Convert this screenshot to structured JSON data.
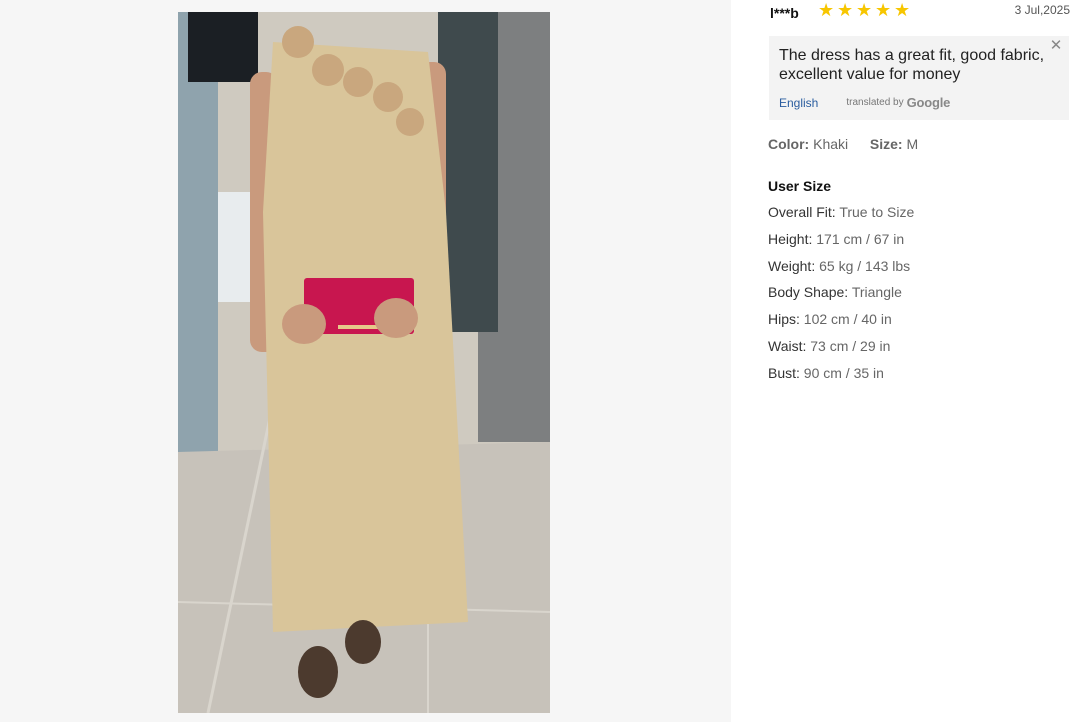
{
  "review": {
    "username": "l***b",
    "rating": 5,
    "date": "3 Jul,2025",
    "translation": {
      "text": "The dress has a great fit, good fabric, excellent value for money",
      "language_link": "English",
      "translated_by": "translated by",
      "provider": "Google",
      "close_icon": "close-icon"
    },
    "attributes": {
      "color_label": "Color:",
      "color_value": "Khaki",
      "size_label": "Size:",
      "size_value": "M"
    },
    "user_size": {
      "title": "User Size",
      "rows": [
        {
          "label": "Overall Fit:",
          "value": "True to Size"
        },
        {
          "label": "Height:",
          "value": "171 cm / 67 in"
        },
        {
          "label": "Weight:",
          "value": "65 kg / 143 lbs"
        },
        {
          "label": "Body Shape:",
          "value": "Triangle"
        },
        {
          "label": "Hips:",
          "value": "102 cm / 40 in"
        },
        {
          "label": "Waist:",
          "value": "73 cm / 29 in"
        },
        {
          "label": "Bust:",
          "value": "90 cm / 35 in"
        }
      ]
    }
  },
  "colors": {
    "star": "#f7c600",
    "link": "#2a5d9f",
    "dress": "#d9c59a"
  }
}
